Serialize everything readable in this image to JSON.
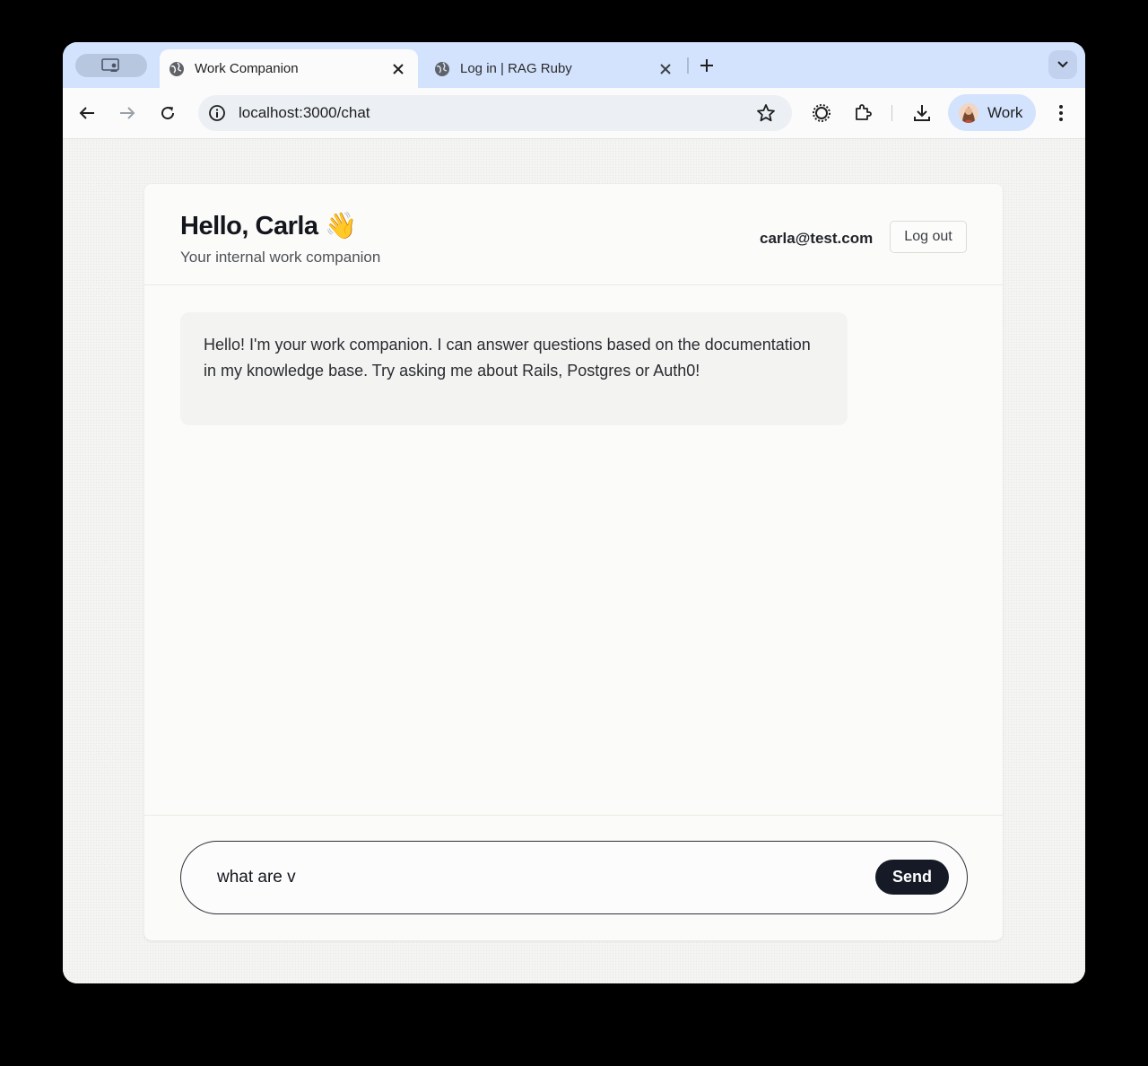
{
  "browser": {
    "tabs": [
      {
        "title": "Work Companion",
        "active": true
      },
      {
        "title": "Log in | RAG Ruby",
        "active": false
      }
    ],
    "url": "localhost:3000/chat",
    "profile_label": "Work"
  },
  "header": {
    "greeting": "Hello, Carla 👋",
    "subtitle": "Your internal work companion",
    "user_email": "carla@test.com",
    "logout_label": "Log out"
  },
  "messages": [
    {
      "role": "assistant",
      "text": "Hello! I'm your work companion. I can answer questions based on the documentation in my knowledge base. Try asking me about Rails, Postgres or Auth0!"
    }
  ],
  "composer": {
    "value": "what are v",
    "send_label": "Send"
  },
  "colors": {
    "tabstrip": "#d3e3fd",
    "send_button": "#151a26",
    "page_background": "#f4f4f2"
  }
}
